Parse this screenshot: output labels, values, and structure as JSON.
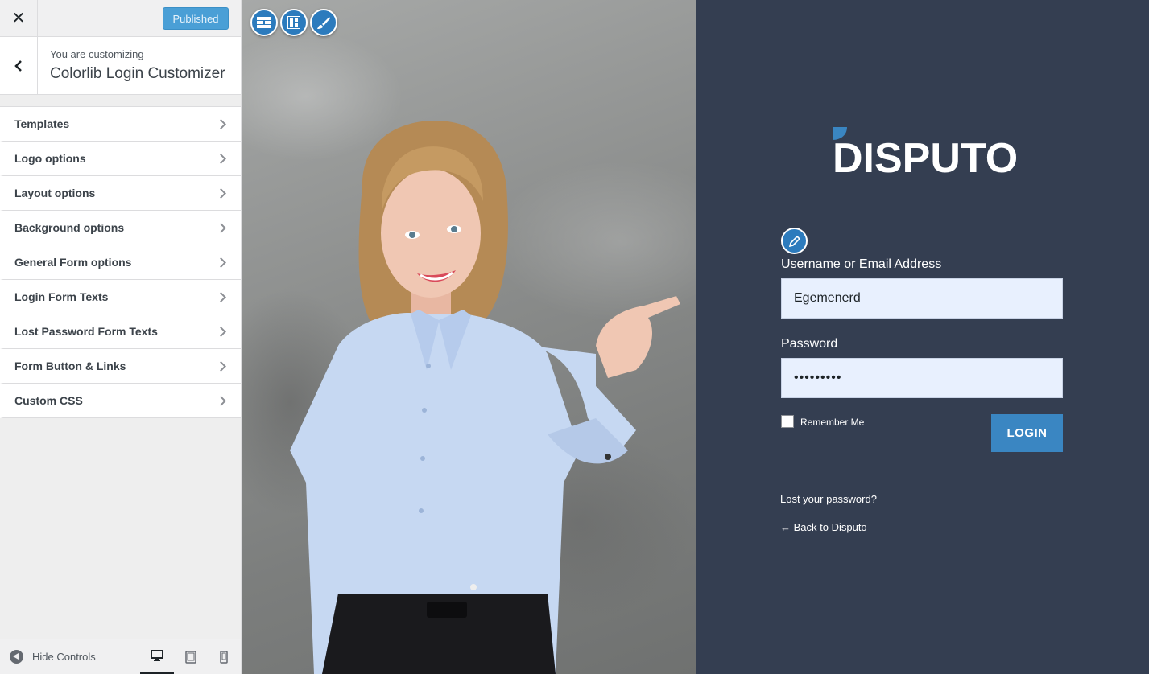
{
  "customizer": {
    "close_label": "✕",
    "publish_label": "Published",
    "customizing_label": "You are customizing",
    "section_title": "Colorlib Login Customizer",
    "panels": [
      {
        "label": "Templates"
      },
      {
        "label": "Logo options"
      },
      {
        "label": "Layout options"
      },
      {
        "label": "Background options"
      },
      {
        "label": "General Form options"
      },
      {
        "label": "Login Form Texts"
      },
      {
        "label": "Lost Password Form Texts"
      },
      {
        "label": "Form Button & Links"
      },
      {
        "label": "Custom CSS"
      }
    ],
    "footer": {
      "hide_controls_label": "Hide Controls",
      "devices": [
        "desktop",
        "tablet",
        "mobile"
      ],
      "active_device": "desktop"
    }
  },
  "preview": {
    "toolbar_icons": [
      "layout-columns-icon",
      "layout-grid-icon",
      "paintbrush-icon"
    ],
    "login": {
      "logo_text": "DISPUTO",
      "username_label": "Username or Email Address",
      "username_value": "Egemenerd",
      "password_label": "Password",
      "password_value": "•••••••••",
      "remember_label": "Remember Me",
      "remember_checked": false,
      "login_button": "LOGIN",
      "lost_password_link": "Lost your password?",
      "back_link": "← Back to Disputo"
    }
  },
  "colors": {
    "publish_blue": "#4a9fd6",
    "login_bg": "#343e51",
    "login_button": "#3a86c2",
    "input_bg": "#e8f0fe",
    "accent_icon": "#2c7bbd"
  }
}
